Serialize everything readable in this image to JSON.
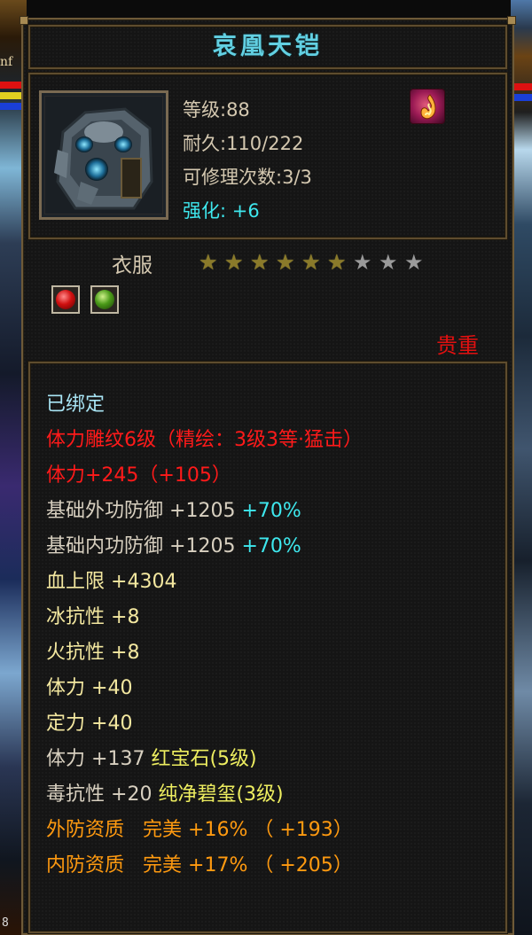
{
  "background": {
    "left_text": "nf",
    "left_number": "8"
  },
  "item": {
    "name": "哀凰天铠",
    "level": "等级:88",
    "durability": "耐久:110/222",
    "repairs": "可修理次数:3/3",
    "enhance_label": "强化:",
    "enhance_value": "+6",
    "type": "衣服",
    "stars_filled": 6,
    "stars_total": 9,
    "rarity": "贵重"
  },
  "attributes": {
    "bound": "已绑定",
    "carve_a": "体力雕纹6级（",
    "carve_b": "精绘：3级3等·猛击",
    "carve_c": "）",
    "vit_a": "体力+245（",
    "vit_b": "+105",
    "vit_c": "）",
    "ext_def": "基础外功防御",
    "ext_def_val": "+1205",
    "ext_def_pct": "+70%",
    "int_def": "基础内功防御",
    "int_def_val": "+1205",
    "int_def_pct": "+70%",
    "hp": "血上限",
    "hp_val": "+4304",
    "ice": "冰抗性",
    "ice_val": "+8",
    "fire": "火抗性",
    "fire_val": "+8",
    "vit2": "体力",
    "vit2_val": "+40",
    "calm": "定力",
    "calm_val": "+40",
    "vit3": "体力",
    "vit3_val": "+137",
    "gem1": "红宝石",
    "gem1_lv": "(5级)",
    "poison": "毒抗性",
    "poison_val": "+20",
    "gem2": "纯净碧玺",
    "gem2_lv": "(3级)",
    "ext_q": "外防资质",
    "ext_q_grade": "完美",
    "ext_q_pct": "+16%",
    "ext_q_paren": "（ +193）",
    "int_q": "内防资质",
    "int_q_grade": "完美",
    "int_q_pct": "+17%",
    "int_q_paren": "（ +205）"
  },
  "colors": {
    "title": "#62d0e2",
    "red": "#ff1a1a",
    "cyan": "#3ee8ee",
    "orange": "#ff9a10",
    "yellow": "#f4e8a0"
  },
  "icons": {
    "badge": "flame-badge-icon",
    "gem_slot_1": "red-gem-icon",
    "gem_slot_2": "green-gem-icon"
  }
}
